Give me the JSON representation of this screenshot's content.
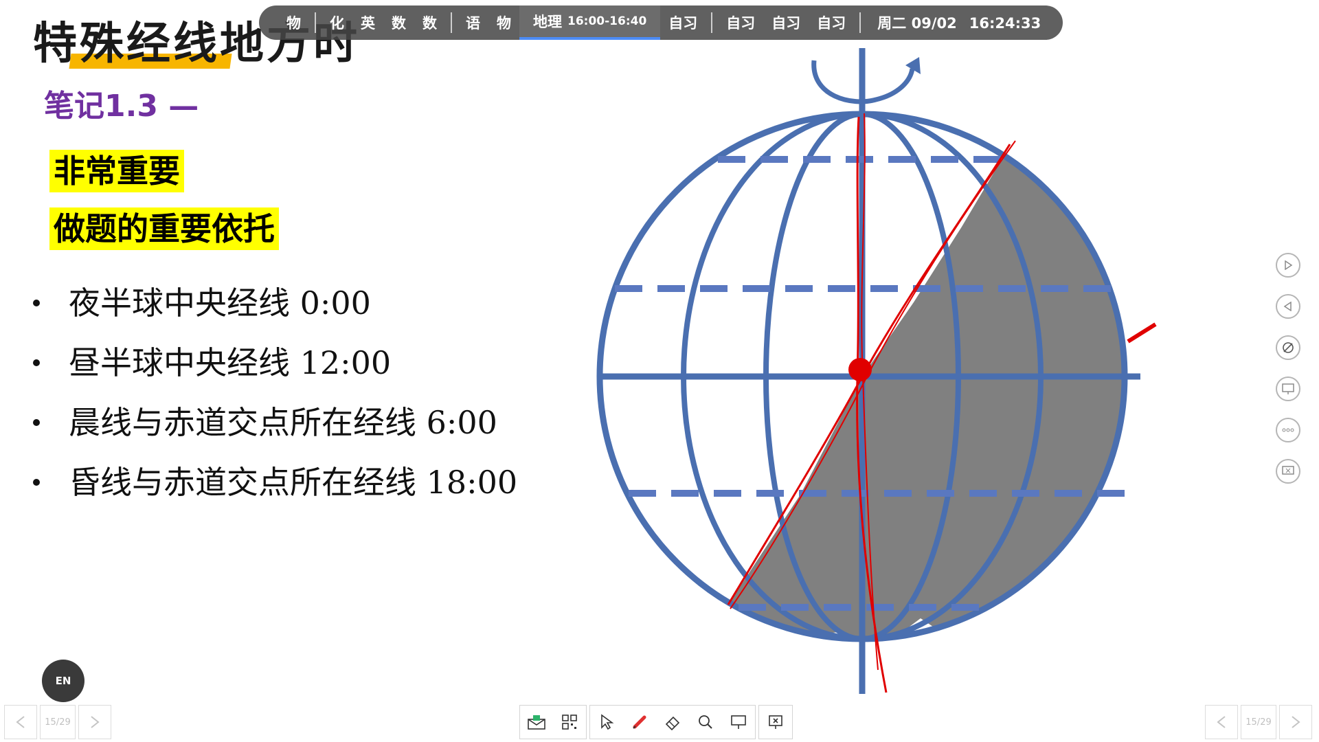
{
  "slide": {
    "title": "特殊经线地方时",
    "note_heading": "笔记1.3 —",
    "highlights": [
      "非常重要",
      "做题的重要依托"
    ],
    "bullets": [
      "夜半球中央经线 0:00",
      "昼半球中央经线 12:00",
      "晨线与赤道交点所在经线 6:00",
      "昏线与赤道交点所在经线 18:00"
    ]
  },
  "schedule": {
    "before": [
      "物",
      "化",
      "英",
      "数",
      "数",
      "语",
      "物"
    ],
    "current": {
      "label": "地理",
      "time": "16:00-16:40"
    },
    "after": [
      "自习",
      "自习",
      "自习",
      "自习"
    ],
    "date": "周二 09/02",
    "clock": "16:24:33"
  },
  "colors": {
    "globe_line": "#4a6fb0",
    "night_shade": "#808080",
    "annotation_red": "#e00000",
    "title_underline": "#f7b500",
    "highlight": "#ffff00",
    "note_heading": "#7030a0",
    "schedule_active": "#4c8bf5"
  },
  "side_tools": [
    "play-next-icon",
    "play-prev-icon",
    "pen-off-icon",
    "screen-share-icon",
    "more-icon",
    "close-screen-icon"
  ],
  "en_badge": "EN",
  "pager": {
    "left": "15/29",
    "right": "15/29"
  },
  "toolbar": [
    "mail-icon",
    "qr-icon",
    "pointer-icon",
    "pen-icon",
    "eraser-icon",
    "zoom-icon",
    "board-icon",
    "exit-slide-icon"
  ]
}
